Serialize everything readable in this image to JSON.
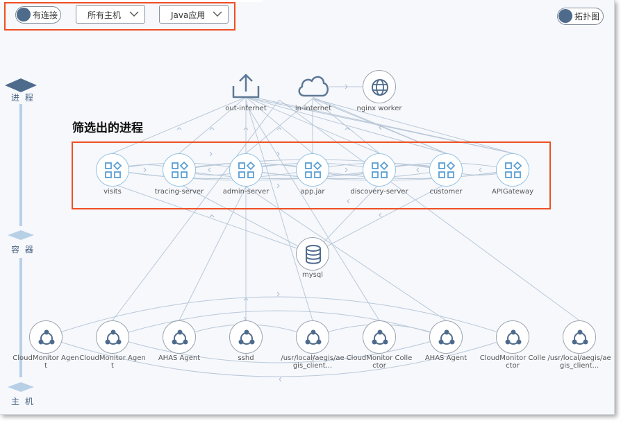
{
  "toolbar": {
    "connected_toggle_label": "有连接",
    "host_select_value": "所有主机",
    "app_select_value": "Java应用",
    "topology_toggle_label": "拓扑图"
  },
  "sidebar": {
    "process_label": "进 程",
    "container_label": "容 器",
    "host_label": "主 机"
  },
  "annotation": "筛选出的进程",
  "internet_nodes": [
    {
      "label": "out-internet",
      "icon": "upload-cloud-icon"
    },
    {
      "label": "in-internet",
      "icon": "cloud-icon"
    },
    {
      "label": "nginx worker",
      "icon": "globe-icon"
    }
  ],
  "process_nodes": [
    {
      "label": "visits"
    },
    {
      "label": "tracing-server"
    },
    {
      "label": "admin-server"
    },
    {
      "label": "app.jar"
    },
    {
      "label": "discovery-server"
    },
    {
      "label": "customer"
    },
    {
      "label": "APIGateway"
    }
  ],
  "container_nodes": [
    {
      "label": "mysql",
      "icon": "database-icon"
    }
  ],
  "host_nodes": [
    {
      "label": "CloudMonitor Agent"
    },
    {
      "label": "CloudMonitor Agent"
    },
    {
      "label": "AHAS Agent"
    },
    {
      "label": "sshd"
    },
    {
      "label": "/usr/local/aegis/aegis_client..."
    },
    {
      "label": "CloudMonitor Collector"
    },
    {
      "label": "AHAS Agent"
    },
    {
      "label": "CloudMonitor Collector"
    },
    {
      "label": "/usr/local/aegis/aegis_client..."
    }
  ],
  "colors": {
    "highlight": "#f04e23",
    "process_border": "#95c3e4",
    "process_icon": "#5a9fd4",
    "edge": "#b9c8d8",
    "sidebar": "#48627f"
  }
}
